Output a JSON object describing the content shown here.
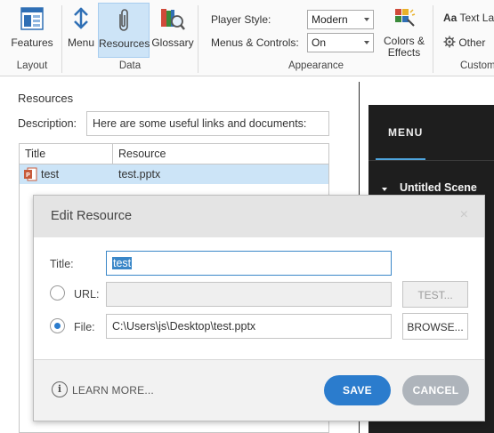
{
  "ribbon": {
    "buttons": {
      "features": "Features",
      "menu": "Menu",
      "resources": "Resources",
      "glossary": "Glossary",
      "colors_effects_line1": "Colors &",
      "colors_effects_line2": "Effects",
      "text_labels": "Text Lab",
      "other": "Other"
    },
    "groups": {
      "layout": "Layout",
      "data": "Data",
      "appearance": "Appearance",
      "customize": "Custom"
    },
    "player_style": {
      "label": "Player Style:",
      "value": "Modern"
    },
    "menus_controls": {
      "label": "Menus & Controls:",
      "value": "On"
    }
  },
  "resources_panel": {
    "title": "Resources",
    "description_label": "Description:",
    "description_value": "Here are some useful links and documents:",
    "columns": [
      "Title",
      "Resource"
    ],
    "rows": [
      {
        "title": "test",
        "resource": "test.pptx"
      }
    ]
  },
  "preview": {
    "menu_tab": "MENU",
    "scene": "Untitled Scene"
  },
  "dialog": {
    "title": "Edit Resource",
    "close": "×",
    "title_label": "Title:",
    "title_value": "test",
    "url_label": "URL:",
    "url_value": "",
    "test_button": "TEST...",
    "file_label": "File:",
    "file_value": "C:\\Users\\js\\Desktop\\test.pptx",
    "browse_button": "BROWSE...",
    "learn_more": "LEARN MORE...",
    "info_glyph": "i",
    "save": "SAVE",
    "cancel": "CANCEL",
    "selected_source": "file"
  },
  "colors": {
    "accent": "#2b7ccd",
    "selection": "#cce4f7",
    "dark_panel": "#1e1e1e"
  },
  "icons": [
    "features-icon",
    "menu-icon",
    "resources-paperclip-icon",
    "glossary-icon",
    "colors-effects-icon",
    "text-labels-icon",
    "other-gear-icon",
    "powerpoint-file-icon",
    "info-icon",
    "close-icon"
  ]
}
